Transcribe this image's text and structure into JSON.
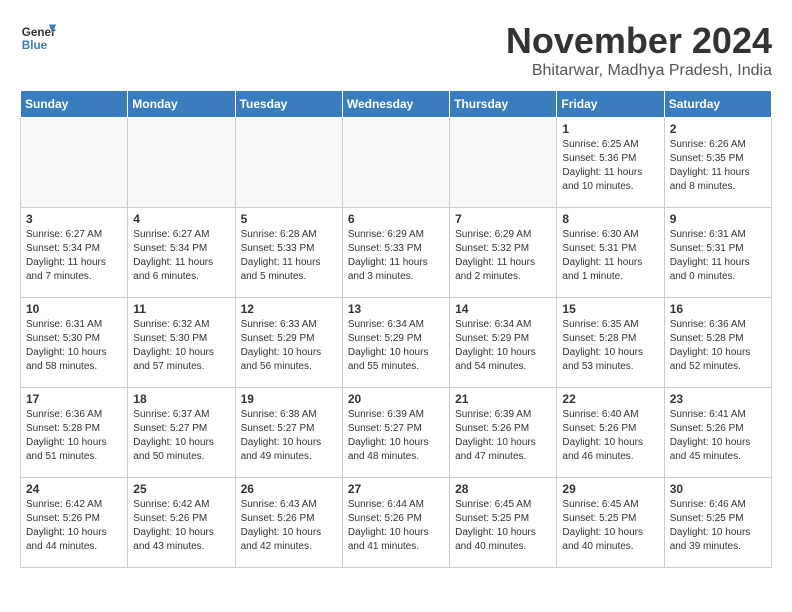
{
  "header": {
    "logo_line1": "General",
    "logo_line2": "Blue",
    "month": "November 2024",
    "location": "Bhitarwar, Madhya Pradesh, India"
  },
  "days_of_week": [
    "Sunday",
    "Monday",
    "Tuesday",
    "Wednesday",
    "Thursday",
    "Friday",
    "Saturday"
  ],
  "weeks": [
    [
      {
        "day": "",
        "info": ""
      },
      {
        "day": "",
        "info": ""
      },
      {
        "day": "",
        "info": ""
      },
      {
        "day": "",
        "info": ""
      },
      {
        "day": "",
        "info": ""
      },
      {
        "day": "1",
        "info": "Sunrise: 6:25 AM\nSunset: 5:36 PM\nDaylight: 11 hours\nand 10 minutes."
      },
      {
        "day": "2",
        "info": "Sunrise: 6:26 AM\nSunset: 5:35 PM\nDaylight: 11 hours\nand 8 minutes."
      }
    ],
    [
      {
        "day": "3",
        "info": "Sunrise: 6:27 AM\nSunset: 5:34 PM\nDaylight: 11 hours\nand 7 minutes."
      },
      {
        "day": "4",
        "info": "Sunrise: 6:27 AM\nSunset: 5:34 PM\nDaylight: 11 hours\nand 6 minutes."
      },
      {
        "day": "5",
        "info": "Sunrise: 6:28 AM\nSunset: 5:33 PM\nDaylight: 11 hours\nand 5 minutes."
      },
      {
        "day": "6",
        "info": "Sunrise: 6:29 AM\nSunset: 5:33 PM\nDaylight: 11 hours\nand 3 minutes."
      },
      {
        "day": "7",
        "info": "Sunrise: 6:29 AM\nSunset: 5:32 PM\nDaylight: 11 hours\nand 2 minutes."
      },
      {
        "day": "8",
        "info": "Sunrise: 6:30 AM\nSunset: 5:31 PM\nDaylight: 11 hours\nand 1 minute."
      },
      {
        "day": "9",
        "info": "Sunrise: 6:31 AM\nSunset: 5:31 PM\nDaylight: 11 hours\nand 0 minutes."
      }
    ],
    [
      {
        "day": "10",
        "info": "Sunrise: 6:31 AM\nSunset: 5:30 PM\nDaylight: 10 hours\nand 58 minutes."
      },
      {
        "day": "11",
        "info": "Sunrise: 6:32 AM\nSunset: 5:30 PM\nDaylight: 10 hours\nand 57 minutes."
      },
      {
        "day": "12",
        "info": "Sunrise: 6:33 AM\nSunset: 5:29 PM\nDaylight: 10 hours\nand 56 minutes."
      },
      {
        "day": "13",
        "info": "Sunrise: 6:34 AM\nSunset: 5:29 PM\nDaylight: 10 hours\nand 55 minutes."
      },
      {
        "day": "14",
        "info": "Sunrise: 6:34 AM\nSunset: 5:29 PM\nDaylight: 10 hours\nand 54 minutes."
      },
      {
        "day": "15",
        "info": "Sunrise: 6:35 AM\nSunset: 5:28 PM\nDaylight: 10 hours\nand 53 minutes."
      },
      {
        "day": "16",
        "info": "Sunrise: 6:36 AM\nSunset: 5:28 PM\nDaylight: 10 hours\nand 52 minutes."
      }
    ],
    [
      {
        "day": "17",
        "info": "Sunrise: 6:36 AM\nSunset: 5:28 PM\nDaylight: 10 hours\nand 51 minutes."
      },
      {
        "day": "18",
        "info": "Sunrise: 6:37 AM\nSunset: 5:27 PM\nDaylight: 10 hours\nand 50 minutes."
      },
      {
        "day": "19",
        "info": "Sunrise: 6:38 AM\nSunset: 5:27 PM\nDaylight: 10 hours\nand 49 minutes."
      },
      {
        "day": "20",
        "info": "Sunrise: 6:39 AM\nSunset: 5:27 PM\nDaylight: 10 hours\nand 48 minutes."
      },
      {
        "day": "21",
        "info": "Sunrise: 6:39 AM\nSunset: 5:26 PM\nDaylight: 10 hours\nand 47 minutes."
      },
      {
        "day": "22",
        "info": "Sunrise: 6:40 AM\nSunset: 5:26 PM\nDaylight: 10 hours\nand 46 minutes."
      },
      {
        "day": "23",
        "info": "Sunrise: 6:41 AM\nSunset: 5:26 PM\nDaylight: 10 hours\nand 45 minutes."
      }
    ],
    [
      {
        "day": "24",
        "info": "Sunrise: 6:42 AM\nSunset: 5:26 PM\nDaylight: 10 hours\nand 44 minutes."
      },
      {
        "day": "25",
        "info": "Sunrise: 6:42 AM\nSunset: 5:26 PM\nDaylight: 10 hours\nand 43 minutes."
      },
      {
        "day": "26",
        "info": "Sunrise: 6:43 AM\nSunset: 5:26 PM\nDaylight: 10 hours\nand 42 minutes."
      },
      {
        "day": "27",
        "info": "Sunrise: 6:44 AM\nSunset: 5:26 PM\nDaylight: 10 hours\nand 41 minutes."
      },
      {
        "day": "28",
        "info": "Sunrise: 6:45 AM\nSunset: 5:25 PM\nDaylight: 10 hours\nand 40 minutes."
      },
      {
        "day": "29",
        "info": "Sunrise: 6:45 AM\nSunset: 5:25 PM\nDaylight: 10 hours\nand 40 minutes."
      },
      {
        "day": "30",
        "info": "Sunrise: 6:46 AM\nSunset: 5:25 PM\nDaylight: 10 hours\nand 39 minutes."
      }
    ]
  ]
}
